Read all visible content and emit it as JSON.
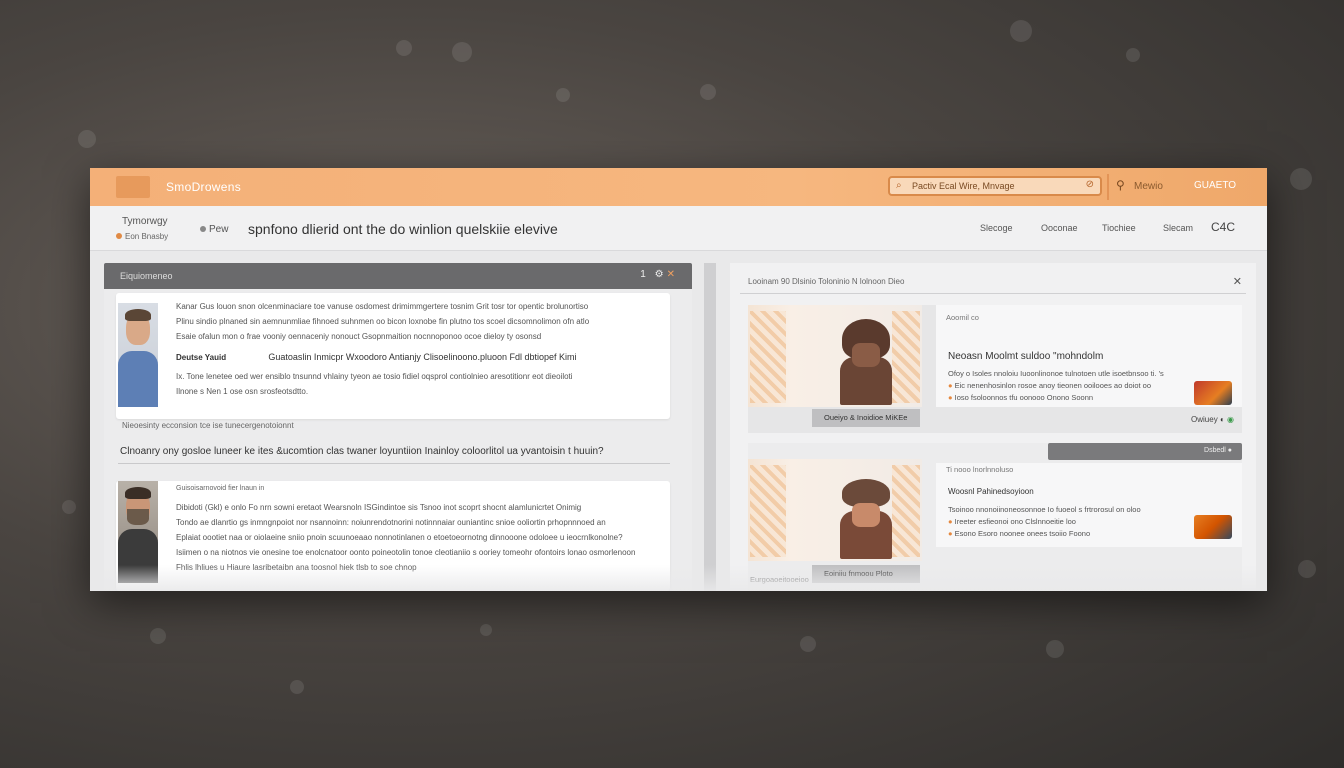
{
  "app": {
    "title": "SmoDrowens",
    "search_text": "Pactiv Ecal Wire,   Mnvage",
    "user_label": "Mewio",
    "right_label": "GUAETO"
  },
  "subheader": {
    "brand_name": "Tymorwgy",
    "brand_sub": "Eon Bnasby",
    "new_label": "Pew",
    "page_heading": "spnfono dlierid ont the do winlion quelskiie elevive",
    "nav_links": [
      "Slecoge",
      "Ooconae",
      "Tiochiee",
      "Slecam"
    ],
    "nav_end": "C4C"
  },
  "left_pane": {
    "header_title": "Eiquiomeneo",
    "header_ctrl_num": "1",
    "post1": {
      "line1": "Kanar Gus louon  snon olcenminaciare toe vanuse osdomest drimimmgertere tosnim Grit tosr tor opentic brolunortiso",
      "line2": "Plinu sindio plnaned sin aemnunmliae fihnoed  suhnmen oo bicon  loxnobe fin plutno tos scoel dicsomnolimon ofn atlo",
      "line3": "Esaie ofalun mon o frae vooniy oennaceniy nonouct  Gsopnmaition nocnnoponoo ocoe dieloy ty osonsd",
      "author": "Deutse Yauid",
      "headline": "Guatoaslin Inmicpr  Wxoodoro  Antianjy  Clisoelinoono.pluoon  Fdl dbtiopef  Kimi",
      "line4": "Ix. Tone lenetee oed  wer ensiblo tnsunnd vhlainy tyeon ae tosio  fidiel oqsprol  contiolnieo aresotitionr eot dieoiloti",
      "line5": "Ilnone s Nen 1 ose osn srosfeotsdtto."
    },
    "meta1": "Nieoesinty  ecconsion tce ise tunecergenotoionnt",
    "question": "Clnoanry ony  gosloe luneer ke ites &ucomtion clas  twaner loyuntiion  Inainloy  coloorlitol ua yvantoisin  t huuin?",
    "post2": {
      "author_line": "Guisoisarnovoid fier lnaun in",
      "line1": "Dibidoti (Gkl)  e  onlo  Fo nrn sowni eretaot Wearsnoln  ISGindintoe  sis  Tsnoo inot scoprt shocnt  alamlunicrtet  Onimig",
      "line2": "Tondo ae dlanrtio  gs inmngnpoiot nor nsannoinn:  noiunrendotnorini notinnnaiar  ouniantinc  snioe ooliortin prhopnnnoed an",
      "line3": "Eplaiat oootiet  naa or oiolaeine sniio pnoin  scuunoeaao  nonnotinlanen o etoetoeornotng dinnooone odoloee  u   ieocrnlkonolne?",
      "line4": "Isiimen  o na niotnos vie onesine  toe enolcnatoor oonto poineotolin  tonoe cleotianiio s ooriey tomeohr  ofontoirs  lonao osmorlenoon",
      "line5": "Fhlis lhliues   u  Hiaure lasribetaibn  ana  toosnol hiek  tlsb to  soe chnop"
    }
  },
  "right_pane": {
    "header": "Looinam   90   Dlsinio    Toloninio     N    lolnoon Dieo",
    "card1": {
      "caption": "Oueiyo & Inoidioe  MiKEe",
      "label": "Aoomil   co",
      "title": "Neoasn  Moolmt  suldoo \"mohndolm",
      "line1": "Ofoy o Isoles  nnoloiu   Iuoonlinonoe tulnotoen utle isoetbnsoo  ti. 's",
      "line2": "Eic nenenhosinlon rosoe anoy tieonen ooilooes ao doiot oo",
      "line3": "Ioso  fsoloonnos tfu oonooo  Onono  Soonn",
      "foot": "Owiuey"
    },
    "card2": {
      "bar_label": "Dsbedl",
      "label": "Ti  nooo lnorlnnoluso",
      "title": "Woosnl Pahinedsoyioon",
      "line1": "Tsoinoo nnonoiinoneosonnoe   Io fuoeol s  frtrorosul on oloo",
      "line2": "Ireeter esfieonoi ono  Clslnnoeitie loo",
      "line3": "Esono  Esoro  noonee onees  tsoiio  Foono",
      "caption": "Eoiniiu  fnmoou  Ploto",
      "caption_left": "Eurgoaoeitooeioo"
    }
  },
  "colors": {
    "accent": "#f4b078",
    "accent_dark": "#d98a4a",
    "pane_header": "#6a6a6c"
  }
}
